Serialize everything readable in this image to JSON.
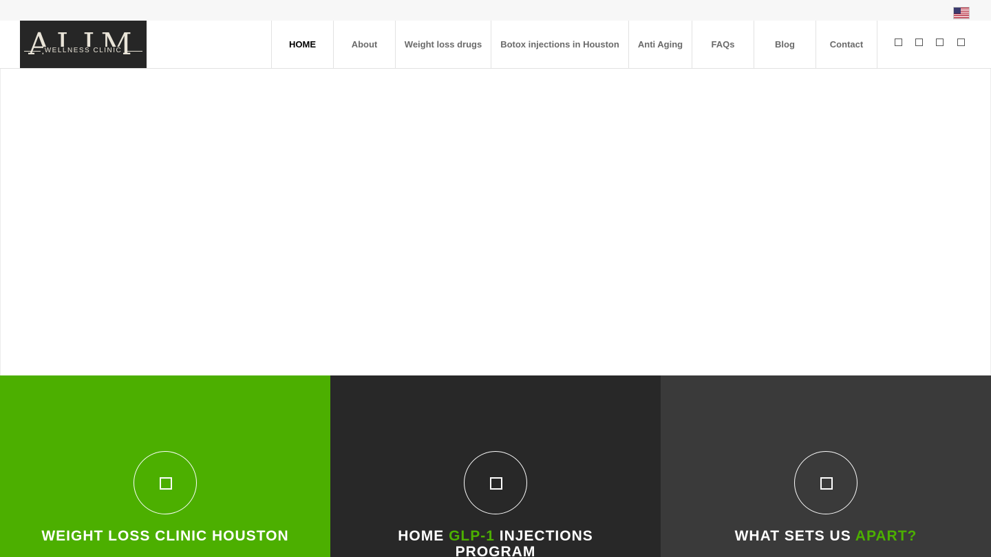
{
  "header": {
    "logo": {
      "big_text": "ALIM",
      "small_text": "WELLNESS CLINIC"
    },
    "nav": [
      {
        "label": "HOME",
        "active": true
      },
      {
        "label": "About",
        "active": false
      },
      {
        "label": "Weight loss drugs",
        "active": false
      },
      {
        "label": "Botox injections in Houston",
        "active": false
      },
      {
        "label": "Anti Aging",
        "active": false
      },
      {
        "label": "FAQs",
        "active": false
      },
      {
        "label": "Blog",
        "active": false
      },
      {
        "label": "Contact",
        "active": false
      }
    ],
    "social_icons": [
      "social-icon-1",
      "social-icon-2",
      "social-icon-3",
      "social-icon-4"
    ],
    "language_flag": "us-flag-icon"
  },
  "features": [
    {
      "bg": "#4caf00",
      "icon": "feature-icon",
      "title_pre": "WEIGHT LOSS CLINIC HOUSTON",
      "title_accent": "",
      "title_post": ""
    },
    {
      "bg": "#282828",
      "icon": "feature-icon",
      "title_pre": "HOME ",
      "title_accent": "GLP-1",
      "title_post": " INJECTIONS PROGRAM"
    },
    {
      "bg": "#3a3a3a",
      "icon": "feature-icon",
      "title_pre": "WHAT SETS US ",
      "title_accent": "APART?",
      "title_post": ""
    }
  ],
  "colors": {
    "accent": "#4caf00",
    "dark": "#282828",
    "darker_gray": "#3a3a3a",
    "topbar": "#f7f7f7"
  }
}
